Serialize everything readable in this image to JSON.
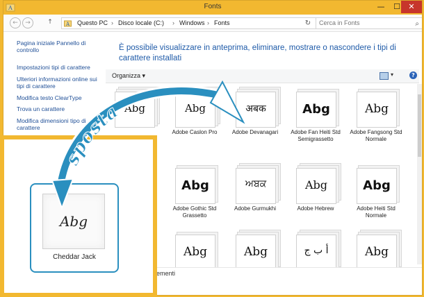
{
  "window": {
    "title": "Fonts",
    "minimize_label": "—",
    "maximize_label": "☐",
    "close_label": "✕"
  },
  "colors": {
    "accent": "#f2b830",
    "link": "#1f4f97",
    "heading": "#1e5aa8",
    "arrow": "#2a8fbf"
  },
  "address": {
    "back_icon": "arrow-left-icon",
    "back_label": "←",
    "forward_label": "→",
    "up_label": "↑",
    "segments": [
      "Questo PC",
      "Disco locale (C:)",
      "Windows",
      "Fonts"
    ],
    "separator": "›",
    "refresh_label": "↻",
    "search_placeholder": "Cerca in Fonts",
    "search_icon_glyph": "⌕"
  },
  "sidebar": {
    "items": [
      "Pagina iniziale Pannello di controllo",
      "Impostazioni tipi di carattere",
      "Ulteriori informazioni online sui tipi di carattere",
      "Modifica testo ClearType",
      "Trova un carattere",
      "Modifica dimensioni tipo di carattere"
    ]
  },
  "main": {
    "heading": "È possibile visualizzare in anteprima, eliminare, mostrare o nascondere i tipi di carattere installati",
    "organize_label": "Organizza ▾",
    "view_caret": "▾",
    "help_label": "?"
  },
  "fonts": [
    {
      "sample": "Abg",
      "name": "",
      "stacked": true
    },
    {
      "sample": "Abg",
      "name": "Adobe Caslon Pro",
      "stacked": true
    },
    {
      "sample": "अबक",
      "name": "Adobe Devanagari",
      "stacked": true
    },
    {
      "sample": "Abg",
      "name": "Adobe Fan Heiti Std Semigrassetto",
      "stacked": false
    },
    {
      "sample": "Abg",
      "name": "Adobe Fangsong Std Normale",
      "stacked": false
    },
    {
      "sample": "Abg",
      "name": "Adobe Gothic Std Grassetto",
      "stacked": false
    },
    {
      "sample": "ਅਬਕ",
      "name": "Adobe Gurmukhi",
      "stacked": true
    },
    {
      "sample": "Abg",
      "name": "Adobe Hebrew",
      "stacked": true
    },
    {
      "sample": "Abg",
      "name": "Adobe Heiti Std Normale",
      "stacked": false
    },
    {
      "sample": "Abg",
      "name": "",
      "stacked": false
    },
    {
      "sample": "Abg",
      "name": "",
      "stacked": true
    },
    {
      "sample": "أ ب ج",
      "name": "",
      "stacked": true
    },
    {
      "sample": "Abg",
      "name": "",
      "stacked": true
    }
  ],
  "status": {
    "text": "lementi"
  },
  "overlay": {
    "font_sample": "Abg",
    "font_name": "Cheddar Jack",
    "arrow_text": "sposta"
  }
}
